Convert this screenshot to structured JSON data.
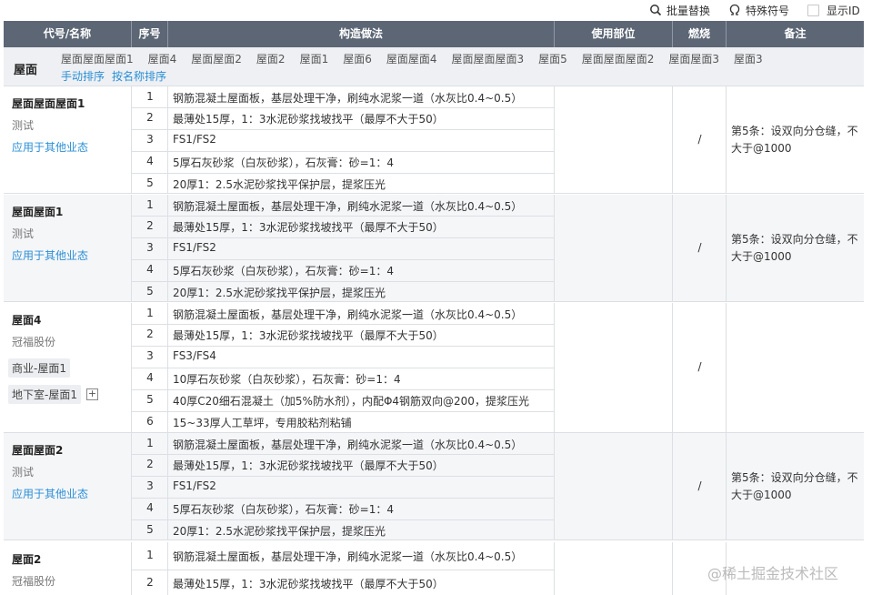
{
  "toolbar": {
    "batch_replace": "批量替换",
    "special_chars": "特殊符号",
    "show_id": "显示ID"
  },
  "columns": {
    "code_name": "代号/名称",
    "seq": "序号",
    "method": "构造做法",
    "use": "使用部位",
    "burn": "燃烧",
    "note": "备注"
  },
  "filter": {
    "title": "屋面",
    "tabs": [
      "屋面屋面屋面1",
      "屋面4",
      "屋面屋面2",
      "屋面2",
      "屋面1",
      "屋面6",
      "屋面屋面4",
      "屋面屋面屋面3",
      "屋面5",
      "屋面屋面屋面2",
      "屋面屋面3",
      "屋面3"
    ],
    "manual_sort": "手动排序",
    "name_sort": "按名称排序"
  },
  "groups": [
    {
      "name": "屋面屋面屋面1",
      "sub": "测试",
      "link": "应用于其他业态",
      "burn": "/",
      "note": "第5条：设双向分仓缝，不大于@1000",
      "rows": [
        {
          "seq": "1",
          "text": "钢筋混凝土屋面板，基层处理干净，刷纯水泥浆一道（水灰比0.4~0.5）"
        },
        {
          "seq": "2",
          "text": "最薄处15厚，1：3水泥砂浆找坡找平（最厚不大于50）"
        },
        {
          "seq": "3",
          "text": "FS1/FS2"
        },
        {
          "seq": "4",
          "text": "5厚石灰砂浆（白灰砂浆），石灰膏：砂=1：4"
        },
        {
          "seq": "5",
          "text": "20厚1：2.5水泥砂浆找平保护层，提浆压光"
        }
      ]
    },
    {
      "name": "屋面屋面1",
      "sub": "测试",
      "link": "应用于其他业态",
      "burn": "/",
      "note": "第5条：设双向分仓缝，不大于@1000",
      "rows": [
        {
          "seq": "1",
          "text": "钢筋混凝土屋面板，基层处理干净，刷纯水泥浆一道（水灰比0.4~0.5）"
        },
        {
          "seq": "2",
          "text": "最薄处15厚，1：3水泥砂浆找坡找平（最厚不大于50）"
        },
        {
          "seq": "3",
          "text": "FS1/FS2"
        },
        {
          "seq": "4",
          "text": "5厚石灰砂浆（白灰砂浆），石灰膏：砂=1：4"
        },
        {
          "seq": "5",
          "text": "20厚1：2.5水泥砂浆找平保护层，提浆压光"
        }
      ]
    },
    {
      "name": "屋面4",
      "sub": "冠福股份",
      "tags": [
        "商业-屋面1",
        "地下室-屋面1"
      ],
      "burn": "/",
      "note": "",
      "rows": [
        {
          "seq": "1",
          "text": "钢筋混凝土屋面板，基层处理干净，刷纯水泥浆一道（水灰比0.4~0.5）"
        },
        {
          "seq": "2",
          "text": "最薄处15厚，1：3水泥砂浆找坡找平（最厚不大于50）"
        },
        {
          "seq": "3",
          "text": "FS3/FS4"
        },
        {
          "seq": "4",
          "text": "10厚石灰砂浆（白灰砂浆），石灰膏：砂=1：4"
        },
        {
          "seq": "5",
          "text": "40厚C20细石混凝土（加5%防水剂），内配Φ4钢筋双向@200，提浆压光"
        },
        {
          "seq": "6",
          "text": "15~33厚人工草坪，专用胶粘剂粘铺"
        }
      ]
    },
    {
      "name": "屋面屋面2",
      "sub": "测试",
      "link": "应用于其他业态",
      "burn": "/",
      "note": "第5条：设双向分仓缝，不大于@1000",
      "rows": [
        {
          "seq": "1",
          "text": "钢筋混凝土屋面板，基层处理干净，刷纯水泥浆一道（水灰比0.4~0.5）"
        },
        {
          "seq": "2",
          "text": "最薄处15厚，1：3水泥砂浆找坡找平（最厚不大于50）"
        },
        {
          "seq": "3",
          "text": "FS1/FS2"
        },
        {
          "seq": "4",
          "text": "5厚石灰砂浆（白灰砂浆），石灰膏：砂=1：4"
        },
        {
          "seq": "5",
          "text": "20厚1：2.5水泥砂浆找平保护层，提浆压光"
        }
      ]
    },
    {
      "name": "屋面2",
      "sub": "冠福股份",
      "burn": "",
      "note": "",
      "rows": [
        {
          "seq": "1",
          "text": "钢筋混凝土屋面板，基层处理干净，刷纯水泥浆一道（水灰比0.4~0.5）"
        },
        {
          "seq": "2",
          "text": "最薄处15厚，1：3水泥砂浆找坡找平（最厚不大于50）"
        }
      ]
    }
  ],
  "watermark": "@稀土掘金技术社区"
}
